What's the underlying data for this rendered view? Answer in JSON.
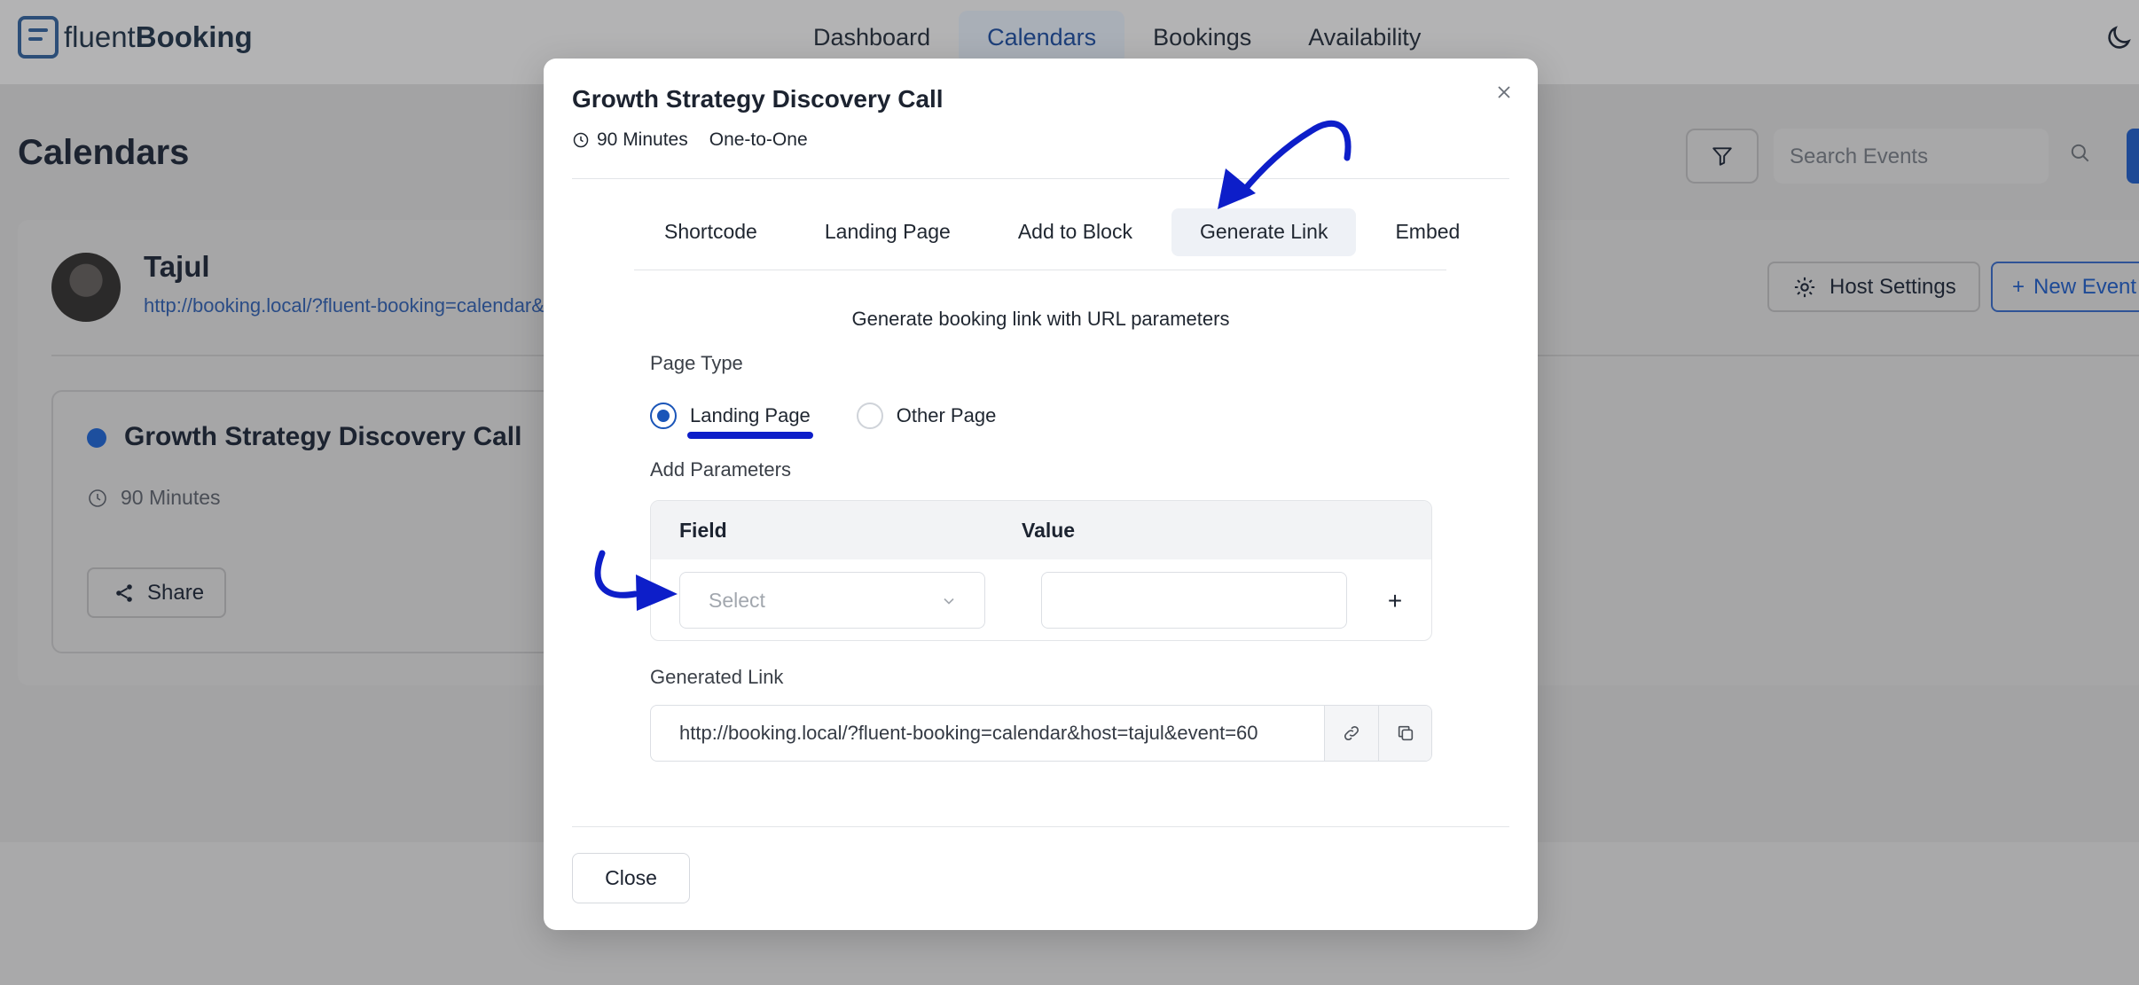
{
  "app": {
    "logo_light": "fluent",
    "logo_bold": "Booking",
    "nav": [
      {
        "label": "Dashboard"
      },
      {
        "label": "Calendars"
      },
      {
        "label": "Bookings"
      },
      {
        "label": "Availability"
      }
    ],
    "page_title": "Calendars",
    "search_placeholder": "Search Events",
    "host": {
      "name": "Tajul",
      "link": "http://booking.local/?fluent-booking=calendar&host=tajul"
    },
    "host_settings_label": "Host Settings",
    "new_event_label": "New Event",
    "event_card": {
      "title": "Growth Strategy Discovery Call",
      "duration": "90 Minutes",
      "share_label": "Share"
    }
  },
  "modal": {
    "title": "Growth Strategy Discovery Call",
    "duration": "90 Minutes",
    "type": "One-to-One",
    "tabs": [
      {
        "label": "Shortcode"
      },
      {
        "label": "Landing Page"
      },
      {
        "label": "Add to Block"
      },
      {
        "label": "Generate Link"
      },
      {
        "label": "Embed"
      }
    ],
    "active_tab": "Generate Link",
    "description": "Generate booking link with URL parameters",
    "page_type_label": "Page Type",
    "page_type_options": [
      {
        "label": "Landing Page",
        "checked": true
      },
      {
        "label": "Other Page",
        "checked": false
      }
    ],
    "add_parameters_label": "Add Parameters",
    "table": {
      "field_header": "Field",
      "value_header": "Value",
      "select_placeholder": "Select",
      "value": "",
      "add_symbol": "+"
    },
    "generated_link_label": "Generated Link",
    "generated_link": "http://booking.local/?fluent-booking=calendar&host=tajul&event=60",
    "close_label": "Close"
  },
  "colors": {
    "accent": "#1a55b8",
    "annotation": "#0d1ec9"
  }
}
